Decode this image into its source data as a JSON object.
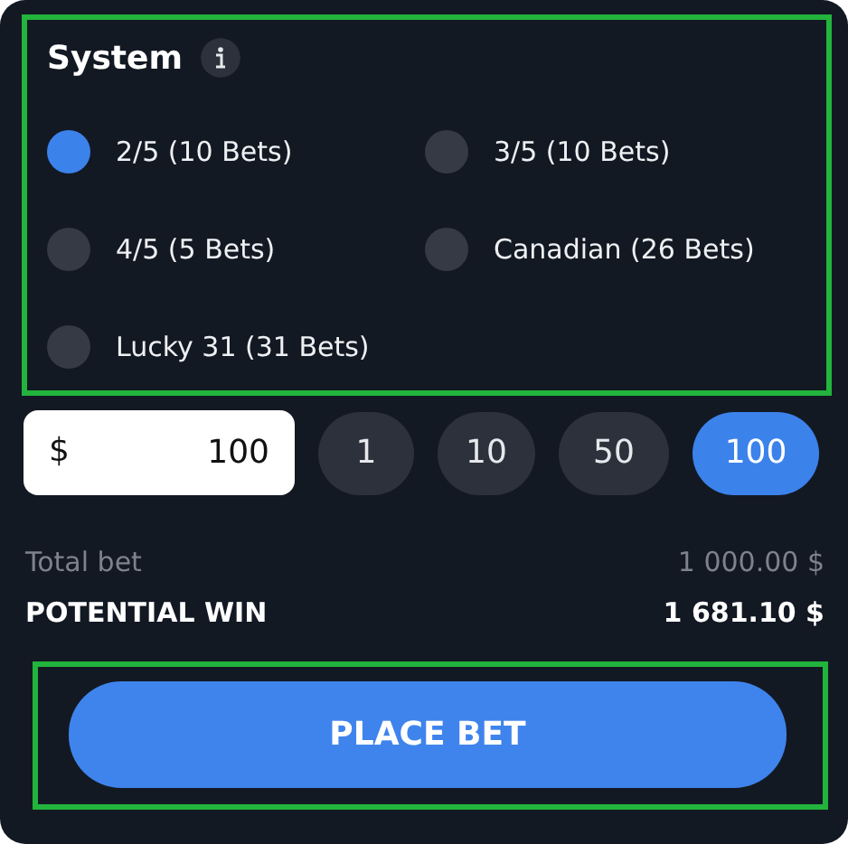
{
  "system": {
    "title": "System",
    "highlighted": true,
    "options": [
      {
        "label": "2/5 (10 Bets)",
        "selected": true
      },
      {
        "label": "3/5 (10 Bets)",
        "selected": false
      },
      {
        "label": "4/5 (5 Bets)",
        "selected": false
      },
      {
        "label": "Canadian (26 Bets)",
        "selected": false
      },
      {
        "label": "Lucky 31 (31 Bets)",
        "selected": false
      }
    ]
  },
  "stake": {
    "currency": "$",
    "value": "100",
    "chips": [
      {
        "label": "1",
        "selected": false
      },
      {
        "label": "10",
        "selected": false
      },
      {
        "label": "50",
        "selected": false
      },
      {
        "label": "100",
        "selected": true
      }
    ]
  },
  "summary": {
    "total_label": "Total bet",
    "total_value": "1 000.00 $",
    "win_label": "POTENTIAL WIN",
    "win_value": "1 681.10 $"
  },
  "place_bet": {
    "label": "PLACE BET",
    "highlighted": true
  }
}
